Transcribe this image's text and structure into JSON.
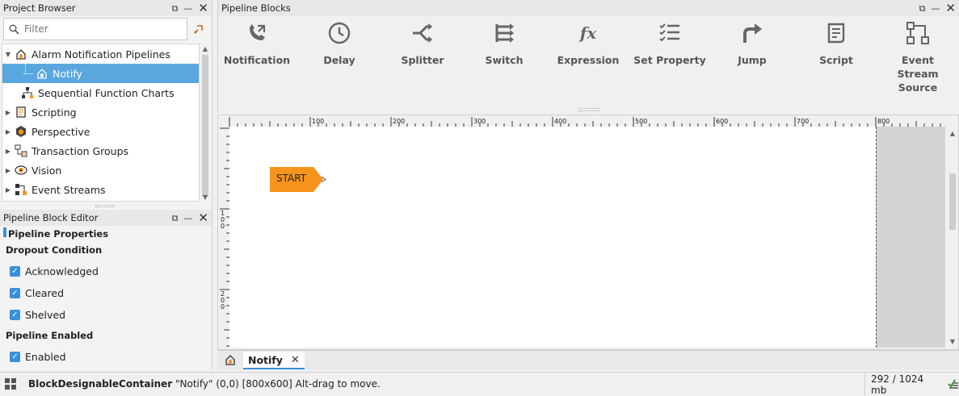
{
  "project_browser": {
    "title": "Project Browser",
    "filter_placeholder": "Filter",
    "tree": [
      {
        "label": "Alarm Notification Pipelines",
        "icon": "alarm-pipeline-icon",
        "expanded": true
      },
      {
        "label": "Notify",
        "icon": "notify-pipeline-icon",
        "selected": true
      },
      {
        "label": "Sequential Function Charts",
        "icon": "sfc-icon"
      },
      {
        "label": "Scripting",
        "icon": "scripting-icon"
      },
      {
        "label": "Perspective",
        "icon": "perspective-icon"
      },
      {
        "label": "Transaction Groups",
        "icon": "transaction-groups-icon"
      },
      {
        "label": "Vision",
        "icon": "vision-icon"
      },
      {
        "label": "Event Streams",
        "icon": "event-streams-icon"
      }
    ]
  },
  "block_editor": {
    "title": "Pipeline Block Editor",
    "section": "Pipeline Properties",
    "dropout_heading": "Dropout Condition",
    "dropout_options": [
      {
        "label": "Acknowledged",
        "checked": true
      },
      {
        "label": "Cleared",
        "checked": true
      },
      {
        "label": "Shelved",
        "checked": true
      }
    ],
    "enabled_heading": "Pipeline Enabled",
    "enabled_option": {
      "label": "Enabled",
      "checked": true
    }
  },
  "pipeline_blocks": {
    "title": "Pipeline Blocks",
    "blocks": [
      {
        "label": "Notification",
        "icon": "notification-icon"
      },
      {
        "label": "Delay",
        "icon": "clock-icon"
      },
      {
        "label": "Splitter",
        "icon": "splitter-icon"
      },
      {
        "label": "Switch",
        "icon": "switch-icon"
      },
      {
        "label": "Expression",
        "icon": "fx-icon"
      },
      {
        "label": "Set Property",
        "icon": "checklist-icon"
      },
      {
        "label": "Jump",
        "icon": "jump-arrow-icon"
      },
      {
        "label": "Script",
        "icon": "script-icon"
      },
      {
        "label": "Event Stream Source",
        "icon": "event-stream-source-icon"
      }
    ]
  },
  "designer": {
    "ruler_top_labels": [
      "100",
      "200",
      "300",
      "400",
      "500",
      "600",
      "700",
      "800"
    ],
    "ruler_left_labels": [
      "100",
      "200"
    ],
    "start_label": "START",
    "colors": {
      "start_block": "#f7941d",
      "offcanvas": "#d4d4d4"
    }
  },
  "tab": {
    "label": "Notify"
  },
  "status": {
    "component": "BlockDesignableContainer",
    "detail": "\"Notify\" (0,0) [800x600] Alt-drag to move.",
    "memory": "292 / 1024 mb"
  }
}
